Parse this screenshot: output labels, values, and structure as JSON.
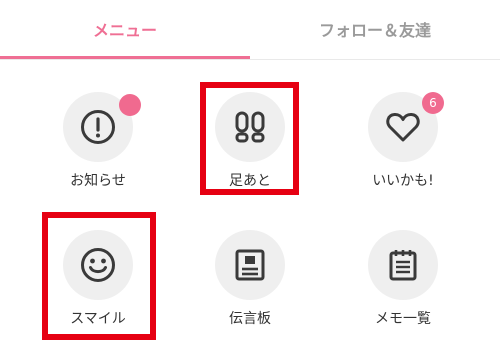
{
  "tabs": [
    {
      "label": "メニュー",
      "active": true
    },
    {
      "label": "フォロー＆友達",
      "active": false
    }
  ],
  "menu": {
    "notifications": {
      "label": "お知らせ",
      "icon": "alert-circle-icon",
      "has_dot": true
    },
    "footprints": {
      "label": "足あと",
      "icon": "footprints-icon"
    },
    "likes": {
      "label": "いいかも!",
      "icon": "heart-icon",
      "badge": "6"
    },
    "smile": {
      "label": "スマイル",
      "icon": "smiley-icon"
    },
    "message_board": {
      "label": "伝言板",
      "icon": "bulletin-board-icon"
    },
    "memo": {
      "label": "メモ一覧",
      "icon": "notepad-icon"
    }
  },
  "colors": {
    "accent": "#ef6f94",
    "badge": "#f06a8f",
    "highlight": "#e60012",
    "icon_bg": "#efefef",
    "icon_stroke": "#3a3a3a"
  }
}
